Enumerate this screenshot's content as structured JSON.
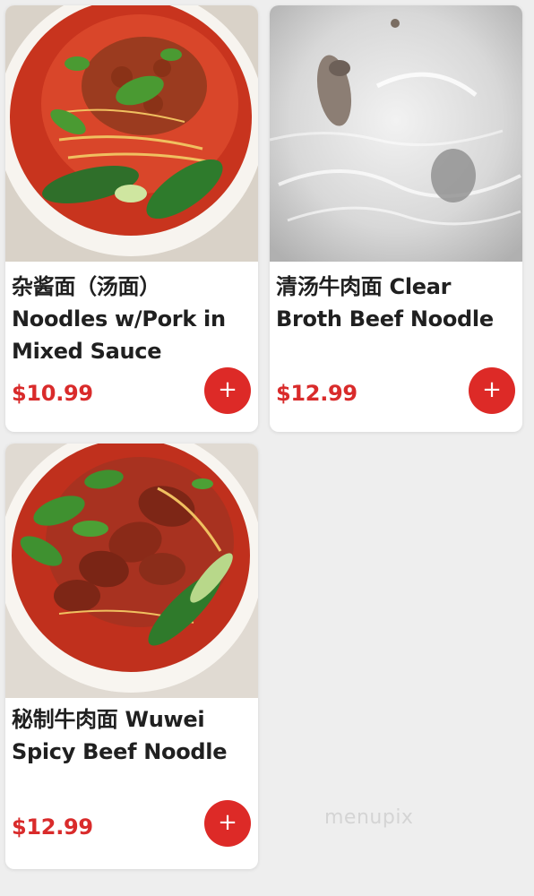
{
  "menu": {
    "items": [
      {
        "name": "杂酱面（汤面） Noodles w/Pork in Mixed Sauce",
        "price": "$10.99",
        "add_label": "+"
      },
      {
        "name": "清汤牛肉面 Clear Broth Beef Noodle",
        "price": "$12.99",
        "add_label": "+"
      },
      {
        "name": "秘制牛肉面 Wuwei Spicy Beef Noodle",
        "price": "$12.99",
        "add_label": "+"
      }
    ]
  },
  "watermark": "menupix",
  "colors": {
    "price": "#d92b2b",
    "add_button": "#dd2a27",
    "background": "#eeeeee",
    "card": "#ffffff"
  }
}
